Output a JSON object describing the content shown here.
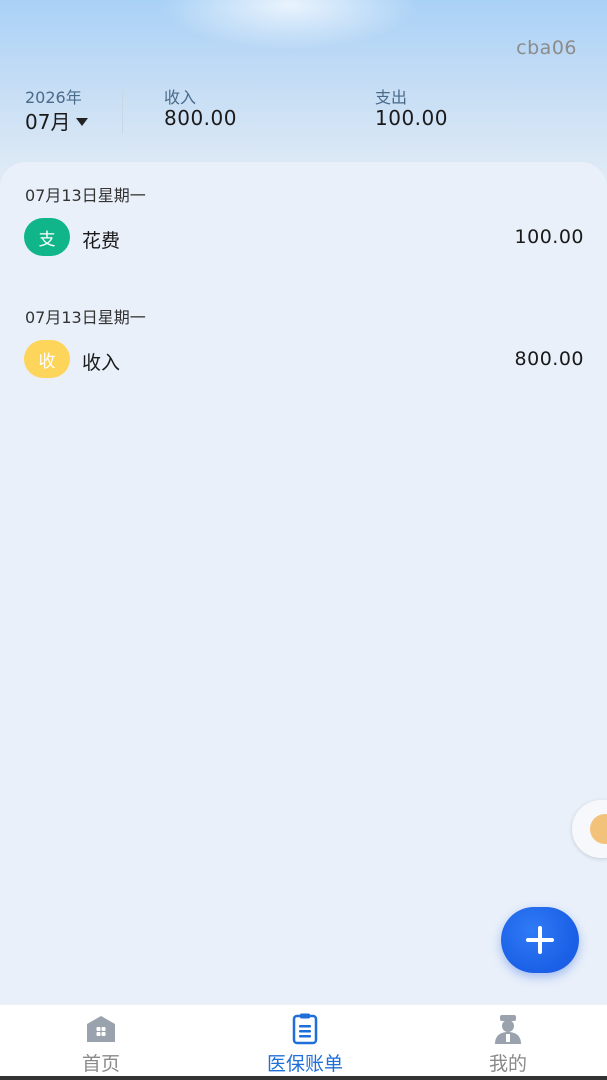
{
  "header": {
    "username": "cba06",
    "year": "2026年",
    "month": "07月",
    "income_label": "收入",
    "income_value": "800.00",
    "expense_label": "支出",
    "expense_value": "100.00"
  },
  "entries": [
    {
      "date": "07月13日星期一",
      "badge": "支",
      "badge_color": "#10b58a",
      "name": "花费",
      "amount": "100.00"
    },
    {
      "date": "07月13日星期一",
      "badge": "收",
      "badge_color": "#fdd55a",
      "name": "收入",
      "amount": "800.00"
    }
  ],
  "fab": {
    "icon": "plus-icon"
  },
  "tabs": [
    {
      "label": "首页",
      "icon": "home-icon"
    },
    {
      "label": "医保账单",
      "icon": "clipboard-icon",
      "active": true
    },
    {
      "label": "我的",
      "icon": "user-icon"
    }
  ],
  "colors": {
    "accent": "#1e6fd9",
    "fab": "#1a5fe6",
    "tab_inactive": "#8a8a8a"
  }
}
